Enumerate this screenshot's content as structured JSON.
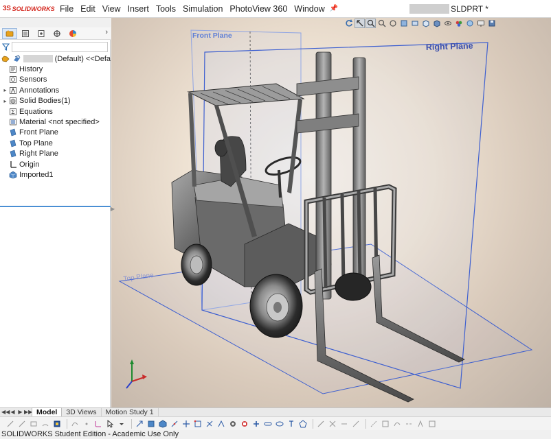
{
  "app": {
    "logo_ds": "3S",
    "logo_word": "SOLIDWORKS",
    "document_suffix": "SLDPRT *"
  },
  "menu": [
    "File",
    "Edit",
    "View",
    "Insert",
    "Tools",
    "Simulation",
    "PhotoView 360",
    "Window"
  ],
  "tree": {
    "root_config": "(Default) <<Defa",
    "items": [
      {
        "label": "History",
        "icon": "history-icon",
        "expandable": false
      },
      {
        "label": "Sensors",
        "icon": "sensors-icon",
        "expandable": false
      },
      {
        "label": "Annotations",
        "icon": "annotations-icon",
        "expandable": true
      },
      {
        "label": "Solid Bodies(1)",
        "icon": "solid-bodies-icon",
        "expandable": true
      },
      {
        "label": "Equations",
        "icon": "equations-icon",
        "expandable": false
      },
      {
        "label": "Material <not specified>",
        "icon": "material-icon",
        "expandable": false
      },
      {
        "label": "Front Plane",
        "icon": "plane-icon",
        "expandable": false
      },
      {
        "label": "Top Plane",
        "icon": "plane-icon",
        "expandable": false
      },
      {
        "label": "Right Plane",
        "icon": "plane-icon",
        "expandable": false
      },
      {
        "label": "Origin",
        "icon": "origin-icon",
        "expandable": false
      },
      {
        "label": "Imported1",
        "icon": "imported-feature-icon",
        "expandable": false
      }
    ]
  },
  "viewport": {
    "front_plane_label": "Front Plane",
    "right_plane_label": "Right Plane",
    "top_plane_label": "Top Plane"
  },
  "bottom_tabs": [
    "Model",
    "3D Views",
    "Motion Study 1"
  ],
  "status": "SOLIDWORKS Student Edition - Academic Use Only",
  "colors": {
    "accent": "#4a8fd4",
    "plane_edge": "#3d5fd0",
    "logo_red": "#d4281f"
  }
}
